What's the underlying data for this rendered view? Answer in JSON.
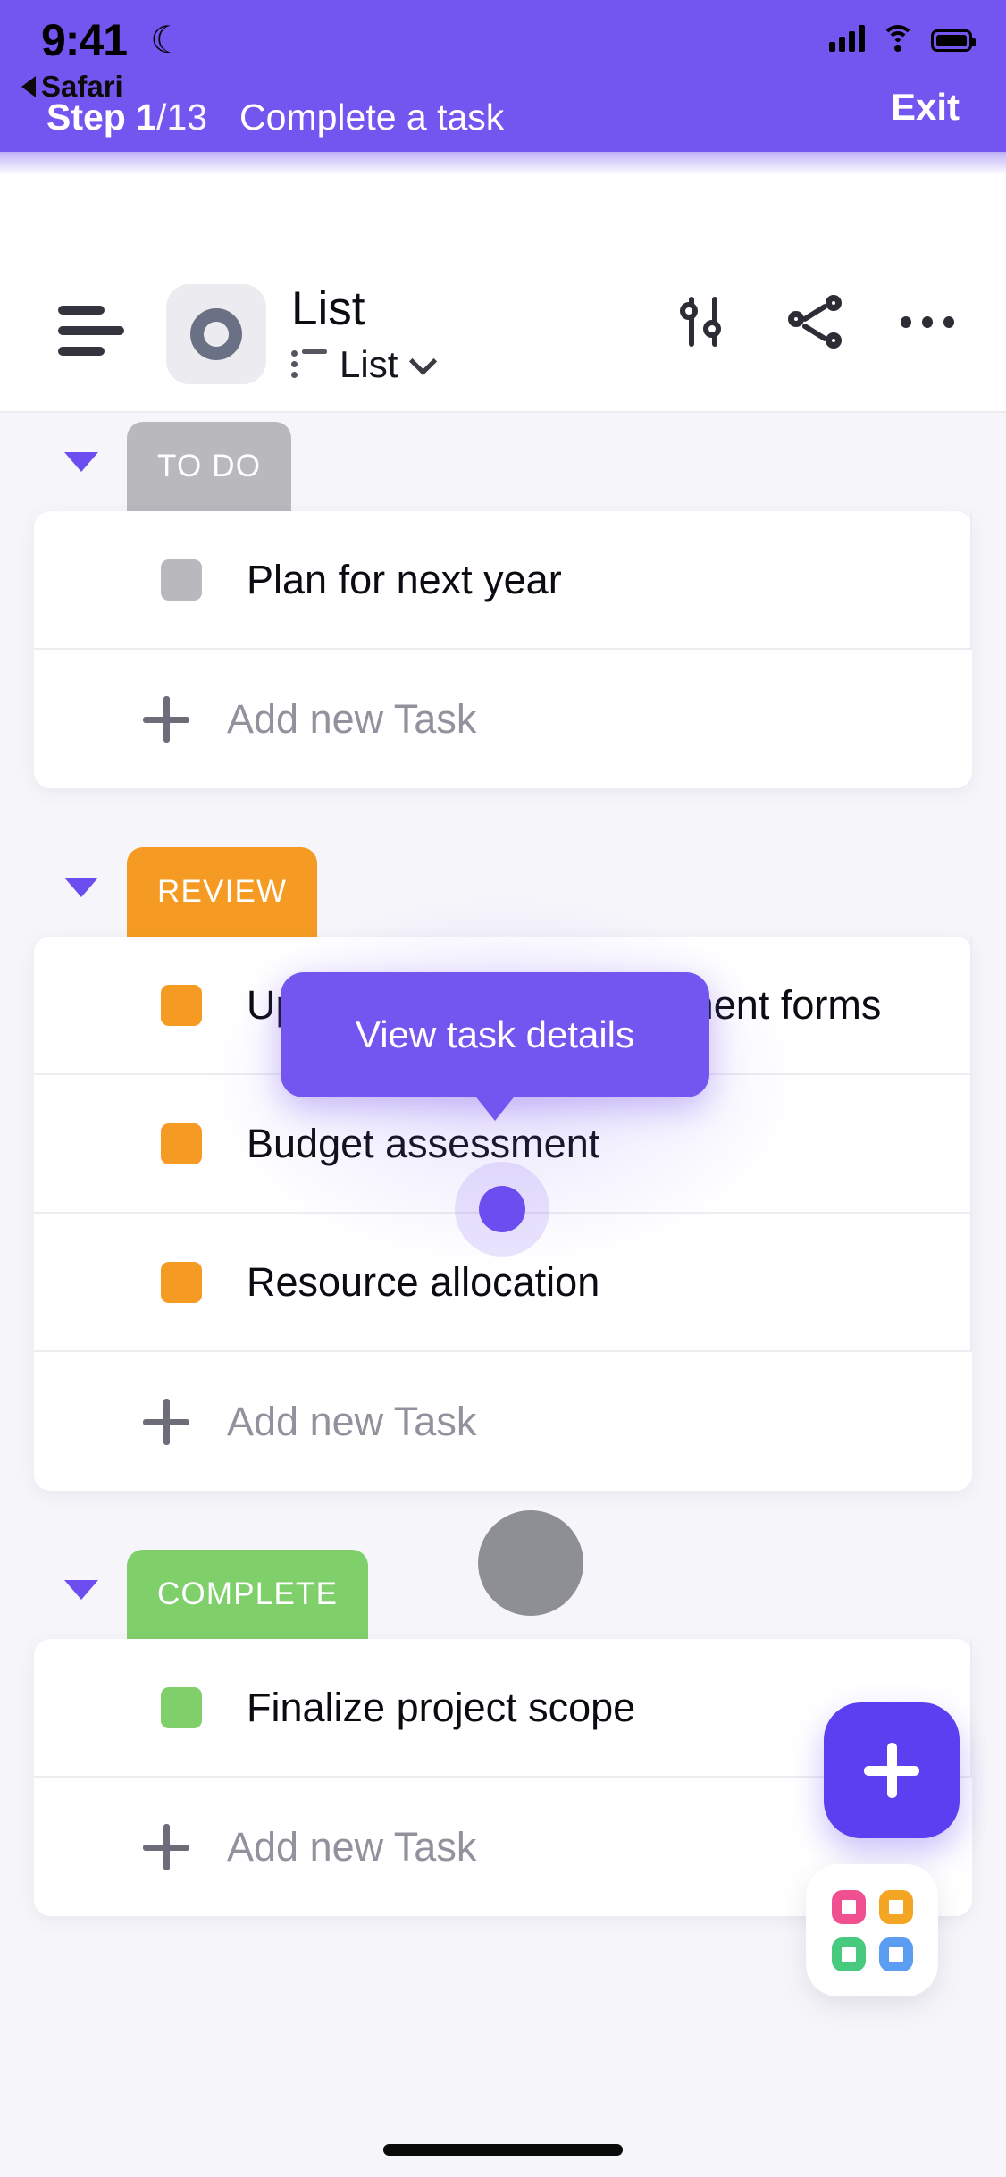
{
  "status_bar": {
    "time": "9:41",
    "moon_icon": "crescent-moon-icon",
    "back_app": "Safari",
    "signal_icon": "cellular-signal-icon",
    "wifi_icon": "wifi-icon",
    "battery_icon": "battery-full-icon"
  },
  "banner": {
    "background": "#7356ef",
    "step_prefix": "Step 1",
    "step_total": "/13",
    "step_title": "Complete a task",
    "exit_label": "Exit"
  },
  "app_header": {
    "menu_icon": "hamburger-menu-icon",
    "avatar_icon": "list-avatar-ring-icon",
    "title": "List",
    "subtitle": "List",
    "subtitle_icon": "list-view-icon",
    "subtitle_chevron": "chevron-down-icon",
    "actions": [
      {
        "name": "filter-sliders-icon",
        "label": "Filter"
      },
      {
        "name": "share-icon",
        "label": "Share"
      },
      {
        "name": "more-options-icon",
        "label": "More"
      }
    ]
  },
  "board": {
    "add_task_label": "Add new Task",
    "groups": [
      {
        "name": "TO DO",
        "color": "#b8b8bd",
        "collapsed": false,
        "tasks": [
          {
            "title": "Plan for next year",
            "status_color": "#b8b8bd"
          }
        ]
      },
      {
        "name": "REVIEW",
        "color": "#f59b23",
        "collapsed": false,
        "tasks": [
          {
            "title": "Update contractor agreement forms",
            "status_color": "#f59b23"
          },
          {
            "title": "Budget assessment",
            "status_color": "#f59b23"
          },
          {
            "title": "Resource allocation",
            "status_color": "#f59b23"
          }
        ]
      },
      {
        "name": "COMPLETE",
        "color": "#7fcf6b",
        "collapsed": false,
        "tasks": [
          {
            "title": "Finalize project scope",
            "status_color": "#7fcf6b"
          }
        ]
      }
    ]
  },
  "tooltip": {
    "text": "View task details",
    "background": "#7356ef"
  },
  "floating": {
    "fab_icon": "plus-icon",
    "fab_color": "#5b3ff0",
    "widget_icon": "app-grid-widget-icon",
    "widget_colors": [
      "#f0508f",
      "#f5a524",
      "#47c97e",
      "#5b9df0"
    ]
  }
}
